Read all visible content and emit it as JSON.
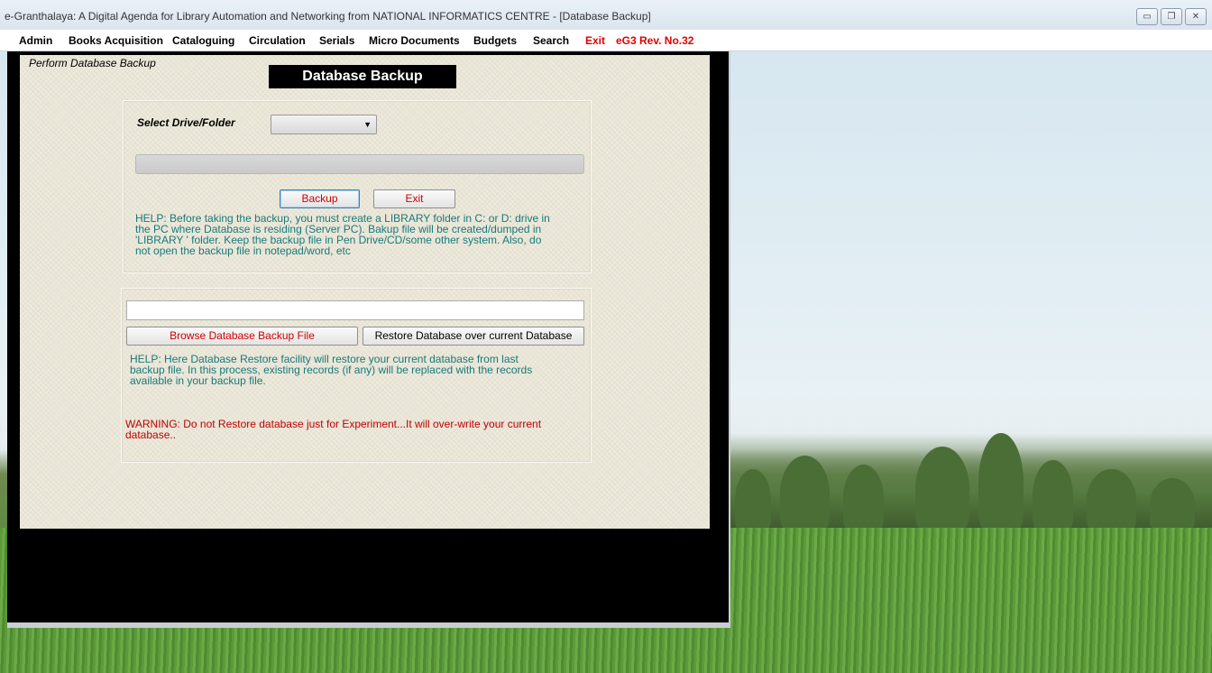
{
  "window": {
    "title": "e-Granthalaya: A Digital Agenda for Library Automation and Networking from NATIONAL INFORMATICS CENTRE - [Database Backup]",
    "controls": {
      "minimize": "▭",
      "restore": "❐",
      "close": "✕"
    }
  },
  "menu": {
    "admin": "Admin",
    "books_acquisition": "Books Acquisition",
    "cataloguing": "Cataloguing",
    "circulation": "Circulation",
    "serials": "Serials",
    "micro_documents": "Micro Documents",
    "budgets": "Budgets",
    "search": "Search",
    "exit": "Exit",
    "revision": "eG3 Rev. No.32"
  },
  "form": {
    "perform_label": "Perform Database Backup",
    "header": "Database Backup",
    "backup_section": {
      "select_label": "Select Drive/Folder",
      "selected_value": "",
      "backup_button": "Backup",
      "exit_button": "Exit",
      "help": [
        "HELP: Before taking the backup, you must create a LIBRARY folder in C: or D: drive in",
        "the PC where Database is residing (Server PC). Bakup file will be created/dumped in",
        "'LIBRARY ' folder. Keep the backup file in Pen Drive/CD/some other system. Also, do",
        "not open the backup file in notepad/word, etc"
      ]
    },
    "restore_section": {
      "file_path_value": "",
      "browse_button": "Browse Database Backup File",
      "restore_button": "Restore Database over current Database",
      "help": [
        "HELP: Here Database Restore facility will restore your current database from last",
        "backup file. In this process, existing records (if any) will be replaced with the records",
        "available in your backup file."
      ],
      "warning": [
        "WARNING: Do not Restore database just for Experiment...It will over-write your current",
        "database.."
      ]
    }
  },
  "colors": {
    "help_text": "#177a7a",
    "warning_text": "#c00000",
    "menu_accent": "#e00000"
  }
}
